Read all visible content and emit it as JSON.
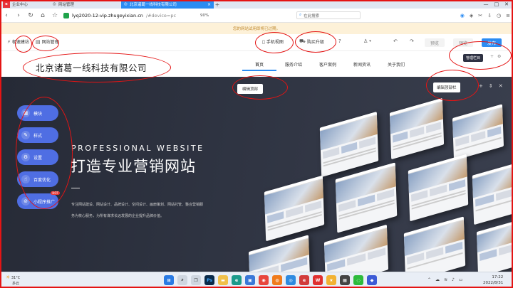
{
  "browser": {
    "tabs": [
      {
        "label": "企业中心",
        "icon": "brand-logo-icon"
      },
      {
        "label": "网站管理",
        "icon": "page-icon"
      },
      {
        "label": "北京诸葛一线科技有限公司",
        "icon": "page-icon",
        "active": true
      }
    ],
    "url_host": "lyq2020-12-vip.zhugeyixian.cn",
    "url_rest": "/#device=pc",
    "zoom": "90%",
    "search_placeholder": "在此搜索"
  },
  "notice": "您的网站试用即将已过期。",
  "toolbar": {
    "quick_build": "极速建站",
    "site_manage": "网站管理",
    "mobile_view": "手机视图",
    "buy_upgrade": "购买升级",
    "preview": "预览",
    "publish": "发布"
  },
  "site": {
    "company_name": "北京诸葛一线科技有限公司",
    "nav": [
      "首页",
      "服务介绍",
      "客户案例",
      "新闻资讯",
      "关于我们"
    ],
    "manage_column": "管理栏目"
  },
  "editor": {
    "edit_top": "编辑顶部",
    "edit_top_bar": "编辑顶部栏"
  },
  "sidebar": {
    "items": [
      {
        "label": "模块",
        "icon": "grid-icon"
      },
      {
        "label": "样式",
        "icon": "brush-icon"
      },
      {
        "label": "设置",
        "icon": "gear-icon"
      },
      {
        "label": "百度优化",
        "icon": "hand-pointer-icon"
      },
      {
        "label": "小程序推广",
        "icon": "compass-icon",
        "badge": "HOT"
      }
    ]
  },
  "hero": {
    "title_en": "PROFESSIONAL WEBSITE",
    "title_cn": "打造专业营销网站",
    "desc_line1": "专注网站建设、网站设计、品牌设计、空间设计、画册策划、网站托管、整合营销服",
    "desc_line2": "务为核心服务，为所有谋求长远发展的企业提升品牌价值。"
  },
  "taskbar": {
    "temperature": "31°C",
    "weather": "多云",
    "time": "17:22",
    "date": "2022/8/31"
  }
}
